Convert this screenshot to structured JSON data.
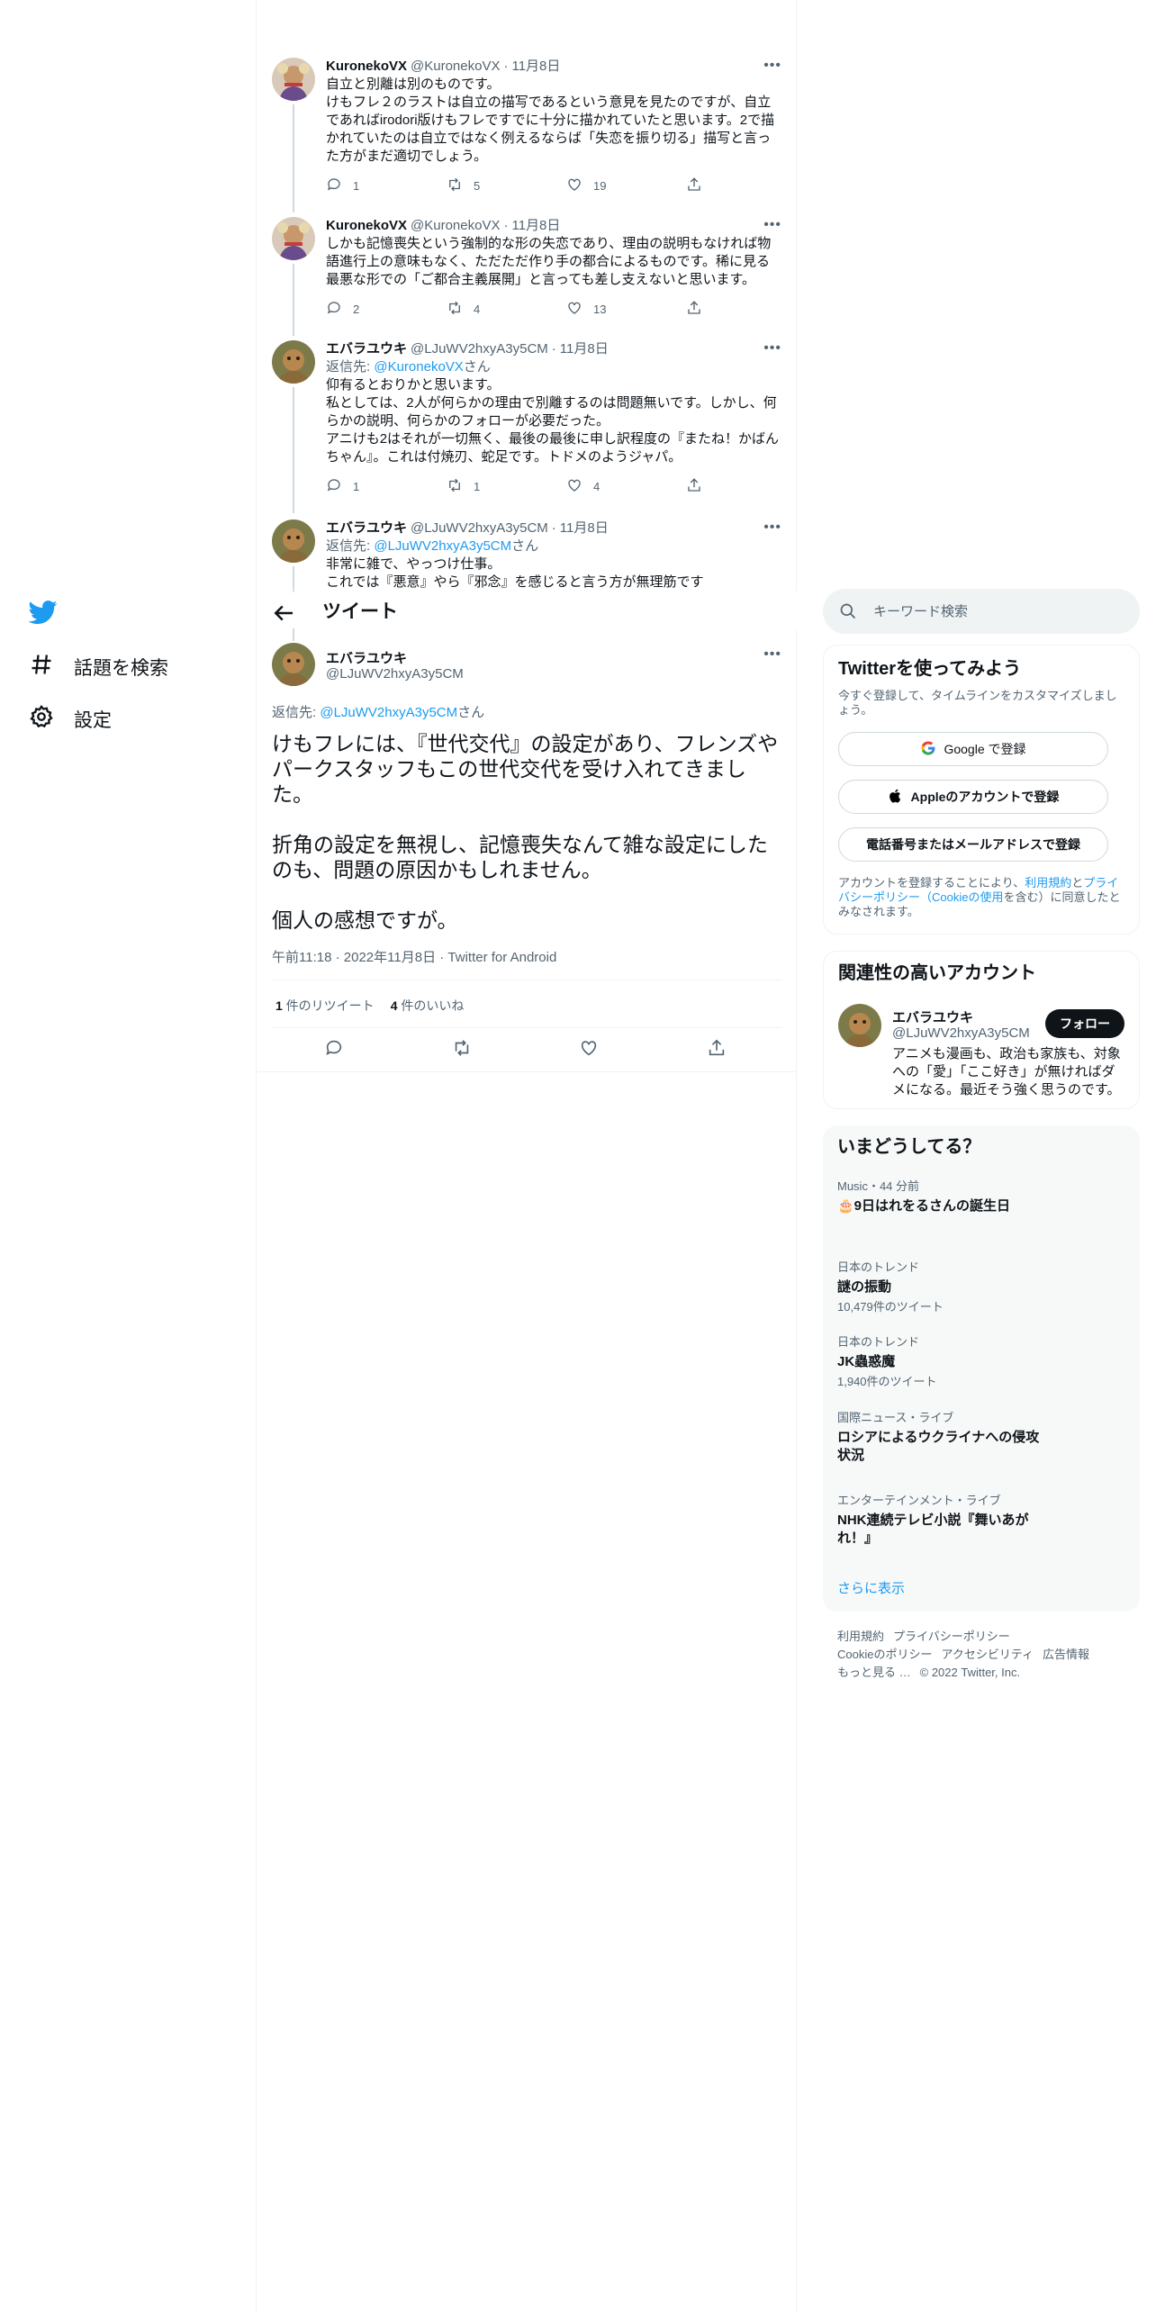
{
  "nav": {
    "explore_label": "話題を検索",
    "settings_label": "設定"
  },
  "thread": [
    {
      "name": "KuronekoVX",
      "handle": "@KuronekoVX",
      "date": "11月8日",
      "reply_to_prefix": "",
      "reply_to_handle": "",
      "reply_to_suffix": "",
      "text": "自立と別離は別のものです。\nけもフレ２のラストは自立の描写であるという意見を見たのですが、自立であればirodori版けもフレですでに十分に描かれていたと思います。2で描かれていたのは自立ではなく例えるならば「失恋を振り切る」描写と言った方がまだ適切でしょう。",
      "replies": "1",
      "retweets": "5",
      "likes": "19"
    },
    {
      "name": "KuronekoVX",
      "handle": "@KuronekoVX",
      "date": "11月8日",
      "reply_to_prefix": "",
      "reply_to_handle": "",
      "reply_to_suffix": "",
      "text": "しかも記憶喪失という強制的な形の失恋であり、理由の説明もなければ物語進行上の意味もなく、ただただ作り手の都合によるものです。稀に見る最悪な形での「ご都合主義展開」と言っても差し支えないと思います。",
      "replies": "2",
      "retweets": "4",
      "likes": "13"
    },
    {
      "name": "エバラユウキ",
      "handle": "@LJuWV2hxyA3y5CM",
      "date": "11月8日",
      "reply_to_prefix": "返信先: ",
      "reply_to_handle": "@KuronekoVX",
      "reply_to_suffix": "さん",
      "text": "仰有るとおりかと思います。\n私としては、2人が何らかの理由で別離するのは問題無いです。しかし、何らかの説明、何らかのフォローが必要だった。\nアニけも2はそれが一切無く、最後の最後に申し訳程度の『またね！かばんちゃん』。これは付焼刃、蛇足です。トドメのようジャパ。",
      "replies": "1",
      "retweets": "1",
      "likes": "4"
    },
    {
      "name": "エバラユウキ",
      "handle": "@LJuWV2hxyA3y5CM",
      "date": "11月8日",
      "reply_to_prefix": "返信先: ",
      "reply_to_handle": "@LJuWV2hxyA3y5CM",
      "reply_to_suffix": "さん",
      "text": "非常に雑で、やっつけ仕事。\nこれでは『悪意』やら『邪念』を感じると言う方が無理筋です"
    }
  ],
  "header": {
    "title": "ツイート"
  },
  "main_tweet": {
    "name": "エバラユウキ",
    "handle": "@LJuWV2hxyA3y5CM",
    "reply_to_prefix": "返信先: ",
    "reply_to_handle": "@LJuWV2hxyA3y5CM",
    "reply_to_suffix": "さん",
    "text": "けもフレには、『世代交代』の設定があり、フレンズやパークスタッフもこの世代交代を受け入れてきました。\n\n折角の設定を無視し、記憶喪失なんて雑な設定にしたのも、問題の原因かもしれません。\n\n個人の感想ですが。",
    "time": "午前11:18",
    "date": "2022年11月8日",
    "source": "Twitter for Android",
    "retweet_count": "1",
    "retweet_label": " 件のリツイート",
    "like_count": "4",
    "like_label": " 件のいいね"
  },
  "search": {
    "placeholder": "キーワード検索"
  },
  "signup": {
    "title": "Twitterを使ってみよう",
    "desc": "今すぐ登録して、タイムラインをカスタマイズしましょう。",
    "google_button": "Google で登録",
    "apple_button": "Appleのアカウントで登録",
    "phone_button": "電話番号またはメールアドレスで登録",
    "legal_prefix": "アカウントを登録することにより、",
    "legal_terms": "利用規約",
    "legal_and": "と",
    "legal_privacy": "プライバシーポリシー（Cookieの使用",
    "legal_suffix": "を含む）に同意したとみなされます。"
  },
  "related": {
    "title": "関連性の高いアカウント",
    "name": "エバラユウキ",
    "handle": "@LJuWV2hxyA3y5CM",
    "bio": "アニメも漫画も、政治も家族も、対象への「愛」「ここ好き」が無ければダメになる。最近そう強く思うのです。",
    "follow_button": "フォロー"
  },
  "trends": {
    "title": "いまどうしてる？",
    "items": [
      {
        "category": "Music・44 分前",
        "title": "🎂9日はれをるさんの誕生日",
        "count": ""
      },
      {
        "category": "日本のトレンド",
        "title": "謎の振動",
        "count": "10,479件のツイート"
      },
      {
        "category": "日本のトレンド",
        "title": "JK蟲惑魔",
        "count": "1,940件のツイート"
      },
      {
        "category": "国際ニュース・ライブ",
        "title": "ロシアによるウクライナへの侵攻状況",
        "count": ""
      },
      {
        "category": "エンターテインメント・ライブ",
        "title": "NHK連続テレビ小説『舞いあがれ！』",
        "count": ""
      }
    ],
    "show_more": "さらに表示"
  },
  "footer": {
    "terms": "利用規約",
    "privacy": "プライバシーポリシー",
    "cookie": "Cookieのポリシー",
    "accessibility": "アクセシビリティ",
    "ads": "広告情報",
    "more": "もっと見る …",
    "copyright": "© 2022 Twitter, Inc."
  },
  "colors": {
    "accent": "#1d9bf0",
    "text": "#0f1419",
    "secondary": "#536471",
    "border": "#eff3f4"
  }
}
